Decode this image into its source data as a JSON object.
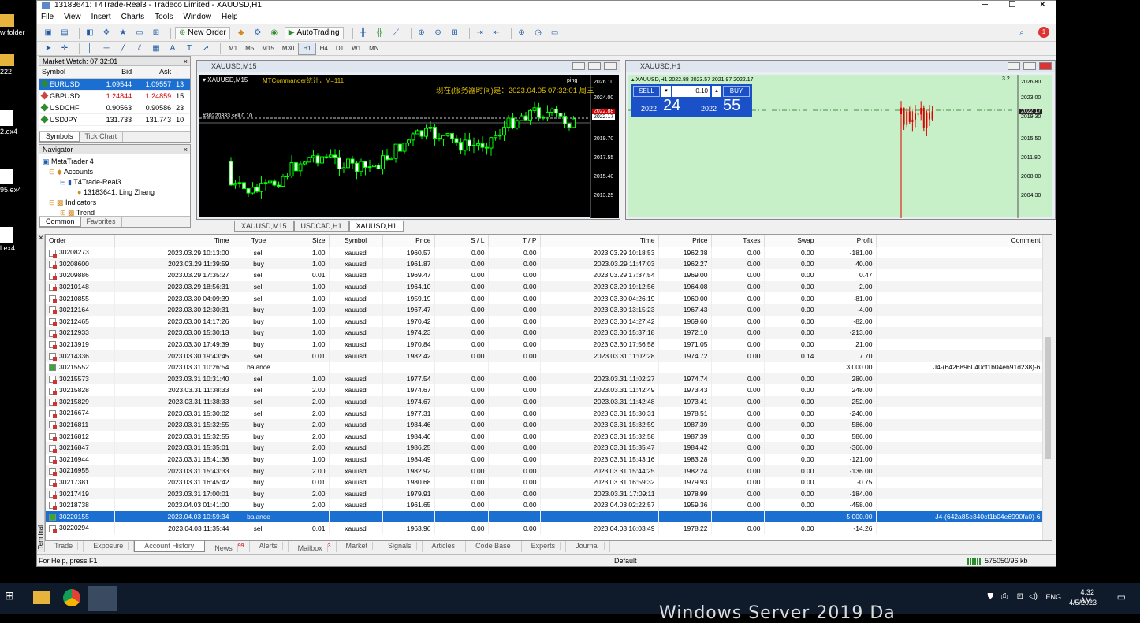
{
  "desktop": {
    "icons": [
      "w folder",
      "222",
      "2.ex4",
      "95.ex4",
      "l.ex4"
    ]
  },
  "window": {
    "title": "13183641: T4Trade-Real3 - Tradeco Limited - XAUUSD,H1",
    "minimize": "─",
    "maximize": "☐",
    "close": "✕"
  },
  "menu": [
    "File",
    "View",
    "Insert",
    "Charts",
    "Tools",
    "Window",
    "Help"
  ],
  "toolbar": {
    "new_order": "New Order",
    "autotrading": "AutoTrading",
    "timeframes": [
      "M1",
      "M5",
      "M15",
      "M30",
      "H1",
      "H4",
      "D1",
      "W1",
      "MN"
    ],
    "active_tf": "H1",
    "notif_count": "1"
  },
  "market_watch": {
    "title": "Market Watch: 07:32:01",
    "columns": [
      "Symbol",
      "Bid",
      "Ask",
      "!"
    ],
    "rows": [
      {
        "symbol": "EURUSD",
        "bid": "1.09544",
        "ask": "1.09557",
        "spread": "13",
        "dir": "up"
      },
      {
        "symbol": "GBPUSD",
        "bid": "1.24844",
        "ask": "1.24859",
        "spread": "15",
        "dir": "down"
      },
      {
        "symbol": "USDCHF",
        "bid": "0.90563",
        "ask": "0.90586",
        "spread": "23",
        "dir": "up"
      },
      {
        "symbol": "USDJPY",
        "bid": "131.733",
        "ask": "131.743",
        "spread": "10",
        "dir": "up"
      }
    ],
    "tabs": [
      "Symbols",
      "Tick Chart"
    ]
  },
  "navigator": {
    "title": "Navigator",
    "items": [
      "MetaTrader 4",
      "Accounts",
      "T4Trade-Real3",
      "13183641: Ling Zhang",
      "Indicators",
      "Trend"
    ],
    "tabs": [
      "Common",
      "Favorites"
    ]
  },
  "chart1": {
    "title": "XAUUSD,M15",
    "header": "XAUUSD,M15",
    "script": "MTCommander统计，M=111",
    "server_time": "现在(服务器时间)是：2023.04.05 07:32:01 周三",
    "ping": "ping",
    "order_line": "#30220333 sell 0.10",
    "prices": [
      "2026.10",
      "2024.00",
      "2022.88",
      "2022.17",
      "2019.70",
      "2017.55",
      "2015.40",
      "2013.25"
    ]
  },
  "chart2": {
    "title": "XAUUSD,H1",
    "header": "XAUUSD,H1  2022.88 2023.57 2021.97 2022.17",
    "version": "3.2",
    "sell_label": "SELL",
    "buy_label": "BUY",
    "lot": "0.10",
    "sell_small": "2022",
    "sell_big": "24",
    "buy_small": "2022",
    "buy_big": "55",
    "prices": [
      "2026.80",
      "2023.00",
      "2022.17",
      "2019.30",
      "2015.50",
      "2011.80",
      "2008.00",
      "2004.30"
    ]
  },
  "chart_tabs": [
    "XAUUSD,M15",
    "USDCAD,H1",
    "XAUUSD,H1"
  ],
  "terminal": {
    "columns": [
      "Order",
      "Time",
      "Type",
      "Size",
      "Symbol",
      "Price",
      "S / L",
      "T / P",
      "Time",
      "Price",
      "Taxes",
      "Swap",
      "Profit",
      "Comment"
    ],
    "rows": [
      [
        "30208273",
        "2023.03.29 10:13:00",
        "sell",
        "1.00",
        "xauusd",
        "1960.57",
        "0.00",
        "0.00",
        "2023.03.29 10:18:53",
        "1962.38",
        "0.00",
        "0.00",
        "-181.00",
        ""
      ],
      [
        "30208600",
        "2023.03.29 11:39:59",
        "buy",
        "1.00",
        "xauusd",
        "1961.87",
        "0.00",
        "0.00",
        "2023.03.29 11:47:03",
        "1962.27",
        "0.00",
        "0.00",
        "40.00",
        ""
      ],
      [
        "30209886",
        "2023.03.29 17:35:27",
        "sell",
        "0.01",
        "xauusd",
        "1969.47",
        "0.00",
        "0.00",
        "2023.03.29 17:37:54",
        "1969.00",
        "0.00",
        "0.00",
        "0.47",
        ""
      ],
      [
        "30210148",
        "2023.03.29 18:56:31",
        "sell",
        "1.00",
        "xauusd",
        "1964.10",
        "0.00",
        "0.00",
        "2023.03.29 19:12:56",
        "1964.08",
        "0.00",
        "0.00",
        "2.00",
        ""
      ],
      [
        "30210855",
        "2023.03.30 04:09:39",
        "sell",
        "1.00",
        "xauusd",
        "1959.19",
        "0.00",
        "0.00",
        "2023.03.30 04:26:19",
        "1960.00",
        "0.00",
        "0.00",
        "-81.00",
        ""
      ],
      [
        "30212164",
        "2023.03.30 12:30:31",
        "buy",
        "1.00",
        "xauusd",
        "1967.47",
        "0.00",
        "0.00",
        "2023.03.30 13:15:23",
        "1967.43",
        "0.00",
        "0.00",
        "-4.00",
        ""
      ],
      [
        "30212465",
        "2023.03.30 14:17:26",
        "buy",
        "1.00",
        "xauusd",
        "1970.42",
        "0.00",
        "0.00",
        "2023.03.30 14:27:42",
        "1969.60",
        "0.00",
        "0.00",
        "-82.00",
        ""
      ],
      [
        "30212933",
        "2023.03.30 15:30:13",
        "buy",
        "1.00",
        "xauusd",
        "1974.23",
        "0.00",
        "0.00",
        "2023.03.30 15:37:18",
        "1972.10",
        "0.00",
        "0.00",
        "-213.00",
        ""
      ],
      [
        "30213919",
        "2023.03.30 17:49:39",
        "buy",
        "1.00",
        "xauusd",
        "1970.84",
        "0.00",
        "0.00",
        "2023.03.30 17:56:58",
        "1971.05",
        "0.00",
        "0.00",
        "21.00",
        ""
      ],
      [
        "30214336",
        "2023.03.30 19:43:45",
        "sell",
        "0.01",
        "xauusd",
        "1982.42",
        "0.00",
        "0.00",
        "2023.03.31 11:02:28",
        "1974.72",
        "0.00",
        "0.14",
        "7.70",
        ""
      ],
      [
        "30215552",
        "2023.03.31 10:26:54",
        "balance",
        "",
        "",
        "",
        "",
        "",
        "",
        "",
        "",
        "",
        "3 000.00",
        "J4-(6426896040cf1b04e691d238)-6"
      ],
      [
        "30215573",
        "2023.03.31 10:31:40",
        "sell",
        "1.00",
        "xauusd",
        "1977.54",
        "0.00",
        "0.00",
        "2023.03.31 11:02:27",
        "1974.74",
        "0.00",
        "0.00",
        "280.00",
        ""
      ],
      [
        "30215828",
        "2023.03.31 11:38:33",
        "sell",
        "2.00",
        "xauusd",
        "1974.67",
        "0.00",
        "0.00",
        "2023.03.31 11:42:49",
        "1973.43",
        "0.00",
        "0.00",
        "248.00",
        ""
      ],
      [
        "30215829",
        "2023.03.31 11:38:33",
        "sell",
        "2.00",
        "xauusd",
        "1974.67",
        "0.00",
        "0.00",
        "2023.03.31 11:42:48",
        "1973.41",
        "0.00",
        "0.00",
        "252.00",
        ""
      ],
      [
        "30216674",
        "2023.03.31 15:30:02",
        "sell",
        "2.00",
        "xauusd",
        "1977.31",
        "0.00",
        "0.00",
        "2023.03.31 15:30:31",
        "1978.51",
        "0.00",
        "0.00",
        "-240.00",
        ""
      ],
      [
        "30216811",
        "2023.03.31 15:32:55",
        "buy",
        "2.00",
        "xauusd",
        "1984.46",
        "0.00",
        "0.00",
        "2023.03.31 15:32:59",
        "1987.39",
        "0.00",
        "0.00",
        "586.00",
        ""
      ],
      [
        "30216812",
        "2023.03.31 15:32:55",
        "buy",
        "2.00",
        "xauusd",
        "1984.46",
        "0.00",
        "0.00",
        "2023.03.31 15:32:58",
        "1987.39",
        "0.00",
        "0.00",
        "586.00",
        ""
      ],
      [
        "30216847",
        "2023.03.31 15:35:01",
        "buy",
        "2.00",
        "xauusd",
        "1986.25",
        "0.00",
        "0.00",
        "2023.03.31 15:35:47",
        "1984.42",
        "0.00",
        "0.00",
        "-366.00",
        ""
      ],
      [
        "30216944",
        "2023.03.31 15:41:38",
        "buy",
        "1.00",
        "xauusd",
        "1984.49",
        "0.00",
        "0.00",
        "2023.03.31 15:43:16",
        "1983.28",
        "0.00",
        "0.00",
        "-121.00",
        ""
      ],
      [
        "30216955",
        "2023.03.31 15:43:33",
        "buy",
        "2.00",
        "xauusd",
        "1982.92",
        "0.00",
        "0.00",
        "2023.03.31 15:44:25",
        "1982.24",
        "0.00",
        "0.00",
        "-136.00",
        ""
      ],
      [
        "30217381",
        "2023.03.31 16:45:42",
        "buy",
        "0.01",
        "xauusd",
        "1980.68",
        "0.00",
        "0.00",
        "2023.03.31 16:59:32",
        "1979.93",
        "0.00",
        "0.00",
        "-0.75",
        ""
      ],
      [
        "30217419",
        "2023.03.31 17:00:01",
        "buy",
        "2.00",
        "xauusd",
        "1979.91",
        "0.00",
        "0.00",
        "2023.03.31 17:09:11",
        "1978.99",
        "0.00",
        "0.00",
        "-184.00",
        ""
      ],
      [
        "30218738",
        "2023.04.03 01:41:00",
        "buy",
        "2.00",
        "xauusd",
        "1961.65",
        "0.00",
        "0.00",
        "2023.04.03 02:22:57",
        "1959.36",
        "0.00",
        "0.00",
        "-458.00",
        ""
      ],
      [
        "30220155",
        "2023.04.03 10:59:34",
        "balance",
        "",
        "",
        "",
        "",
        "",
        "",
        "",
        "",
        "",
        "5 000.00",
        "J4-(642a85e340cf1b04e6990fa0)-6"
      ],
      [
        "30220294",
        "2023.04.03 11:35:44",
        "sell",
        "0.01",
        "xauusd",
        "1963.96",
        "0.00",
        "0.00",
        "2023.04.03 16:03:49",
        "1978.22",
        "0.00",
        "0.00",
        "-14.26",
        ""
      ]
    ],
    "highlight_row": 23,
    "side_label": "Terminal",
    "tabs": [
      {
        "label": "Trade"
      },
      {
        "label": "Exposure"
      },
      {
        "label": "Account History",
        "on": true
      },
      {
        "label": "News",
        "badge": "99"
      },
      {
        "label": "Alerts"
      },
      {
        "label": "Mailbox",
        "badge": "3"
      },
      {
        "label": "Market"
      },
      {
        "label": "Signals"
      },
      {
        "label": "Articles"
      },
      {
        "label": "Code Base"
      },
      {
        "label": "Experts"
      },
      {
        "label": "Journal"
      }
    ]
  },
  "status": {
    "help": "For Help, press F1",
    "profile": "Default",
    "traffic": "575050/96 kb"
  },
  "taskbar": {
    "lang": "ENG",
    "time": "4:32 AM",
    "date": "4/5/2023"
  },
  "watermark": "Windows Server 2019 Da"
}
